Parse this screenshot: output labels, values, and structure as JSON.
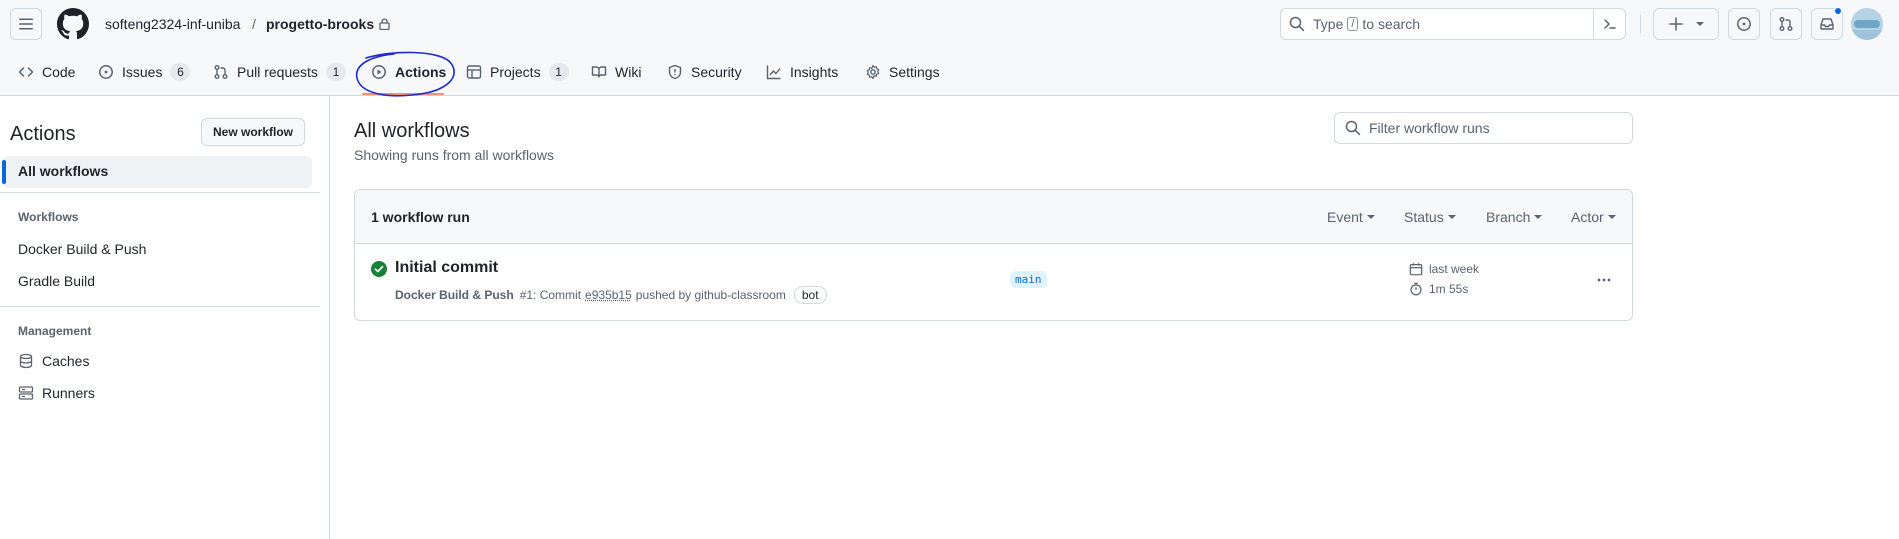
{
  "header": {
    "owner": "softeng2324-inf-uniba",
    "separator": "/",
    "repo": "progetto-brooks",
    "search_prefix": "Type",
    "search_key": "/",
    "search_suffix": "to search"
  },
  "tabs": [
    {
      "label": "Code",
      "icon": "code-icon"
    },
    {
      "label": "Issues",
      "count": "6",
      "icon": "issue-opened-icon"
    },
    {
      "label": "Pull requests",
      "count": "1",
      "icon": "git-pull-request-icon"
    },
    {
      "label": "Actions",
      "icon": "play-icon",
      "active": true
    },
    {
      "label": "Projects",
      "count": "1",
      "icon": "table-icon"
    },
    {
      "label": "Wiki",
      "icon": "book-icon"
    },
    {
      "label": "Security",
      "icon": "shield-icon"
    },
    {
      "label": "Insights",
      "icon": "graph-icon"
    },
    {
      "label": "Settings",
      "icon": "gear-icon"
    }
  ],
  "sidebar": {
    "title": "Actions",
    "new_workflow": "New workflow",
    "all_workflows": "All workflows",
    "workflows_heading": "Workflows",
    "workflows": [
      "Docker Build & Push",
      "Gradle Build"
    ],
    "management_heading": "Management",
    "management": [
      {
        "label": "Caches",
        "icon": "database-icon"
      },
      {
        "label": "Runners",
        "icon": "server-icon"
      }
    ]
  },
  "main": {
    "title": "All workflows",
    "subtitle": "Showing runs from all workflows",
    "filter_placeholder": "Filter workflow runs",
    "run_count": "1 workflow run",
    "filters": [
      "Event",
      "Status",
      "Branch",
      "Actor"
    ],
    "run": {
      "title": "Initial commit",
      "workflow": "Docker Build & Push",
      "run_number": "#1",
      "commit_prefix": ": Commit",
      "sha": "e935b15",
      "pushed_by": "pushed by github-classroom",
      "bot": "bot",
      "branch": "main",
      "when": "last week",
      "duration": "1m 55s",
      "status": "success"
    }
  },
  "colors": {
    "accent": "#0969da",
    "success": "#1a7f37",
    "tab_underline": "#fd8c73",
    "annotation": "#1f2bcc"
  }
}
